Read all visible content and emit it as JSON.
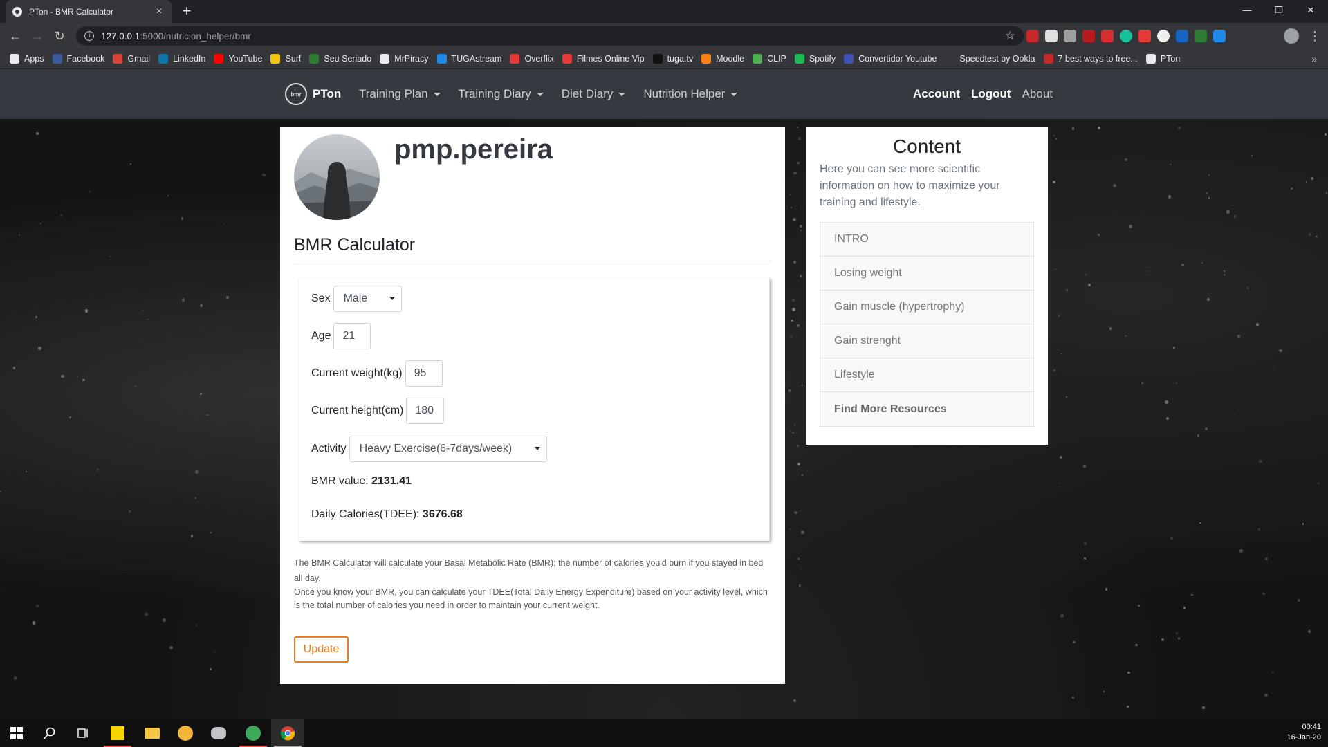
{
  "browser": {
    "tab_title": "PTon - BMR Calculator",
    "tab_close": "×",
    "new_tab": "+",
    "window_min": "—",
    "window_restore": "❐",
    "window_close": "✕",
    "url_host": "127.0.0.1",
    "url_path": ":5000/nutricion_helper/bmr",
    "bookmarks": [
      {
        "label": "Apps",
        "color": "#e8eaed"
      },
      {
        "label": "Facebook",
        "color": "#3b5998"
      },
      {
        "label": "Gmail",
        "color": "#db4437"
      },
      {
        "label": "LinkedIn",
        "color": "#0e76a8"
      },
      {
        "label": "YouTube",
        "color": "#ff0000"
      },
      {
        "label": "Surf",
        "color": "#f1c40f"
      },
      {
        "label": "Seu Seriado",
        "color": "#2e7d32"
      },
      {
        "label": "MrPiracy",
        "color": "#e8eaed"
      },
      {
        "label": "TUGAstream",
        "color": "#1e88e5"
      },
      {
        "label": "Overflix",
        "color": "#e53935"
      },
      {
        "label": "Filmes Online Vip",
        "color": "#e53935"
      },
      {
        "label": "tuga.tv",
        "color": "#111111"
      },
      {
        "label": "Moodle",
        "color": "#f98012"
      },
      {
        "label": "CLIP",
        "color": "#4caf50"
      },
      {
        "label": "Spotify",
        "color": "#1db954"
      },
      {
        "label": "Convertidor Youtube",
        "color": "#3f51b5"
      },
      {
        "label": "Speedtest by Ookla",
        "color": "#35363a"
      },
      {
        "label": "7 best ways to free...",
        "color": "#c62828"
      },
      {
        "label": "PTon",
        "color": "#e8eaed"
      }
    ],
    "bookmarks_more": "»"
  },
  "navbar": {
    "brand": "PTon",
    "logo_text": "bmr",
    "menu": [
      "Training Plan",
      "Training Diary",
      "Diet Diary",
      "Nutrition Helper"
    ],
    "account": "Account",
    "logout": "Logout",
    "about": "About"
  },
  "profile": {
    "username": "pmp.pereira"
  },
  "calculator": {
    "title": "BMR Calculator",
    "sex_label": "Sex",
    "sex_value": "Male",
    "age_label": "Age",
    "age_value": "21",
    "weight_label": "Current weight(kg)",
    "weight_value": "95",
    "height_label": "Current height(cm)",
    "height_value": "180",
    "activity_label": "Activity",
    "activity_value": "Heavy Exercise(6-7days/week)",
    "bmr_label": "BMR value:",
    "bmr_value": "2131.41",
    "tdee_label": "Daily Calories(TDEE):",
    "tdee_value": "3676.68",
    "description_1": "The BMR Calculator will calculate your Basal Metabolic Rate (BMR); the number of calories you'd burn if you stayed in bed all day.",
    "description_2": "Once you know your BMR, you can calculate your TDEE(Total Daily Energy Expenditure) based on your activity level, which is the total number of calories you need in order to maintain your current weight.",
    "update_button": "Update"
  },
  "sidebar": {
    "title": "Content",
    "text": "Here you can see more scientific information on how to maximize your training and lifestyle.",
    "items": [
      "INTRO",
      "Losing weight",
      "Gain muscle (hypertrophy)",
      "Gain strenght",
      "Lifestyle",
      "Find More Resources"
    ]
  },
  "taskbar": {
    "time": "00:41",
    "date": "16-Jan-20"
  }
}
